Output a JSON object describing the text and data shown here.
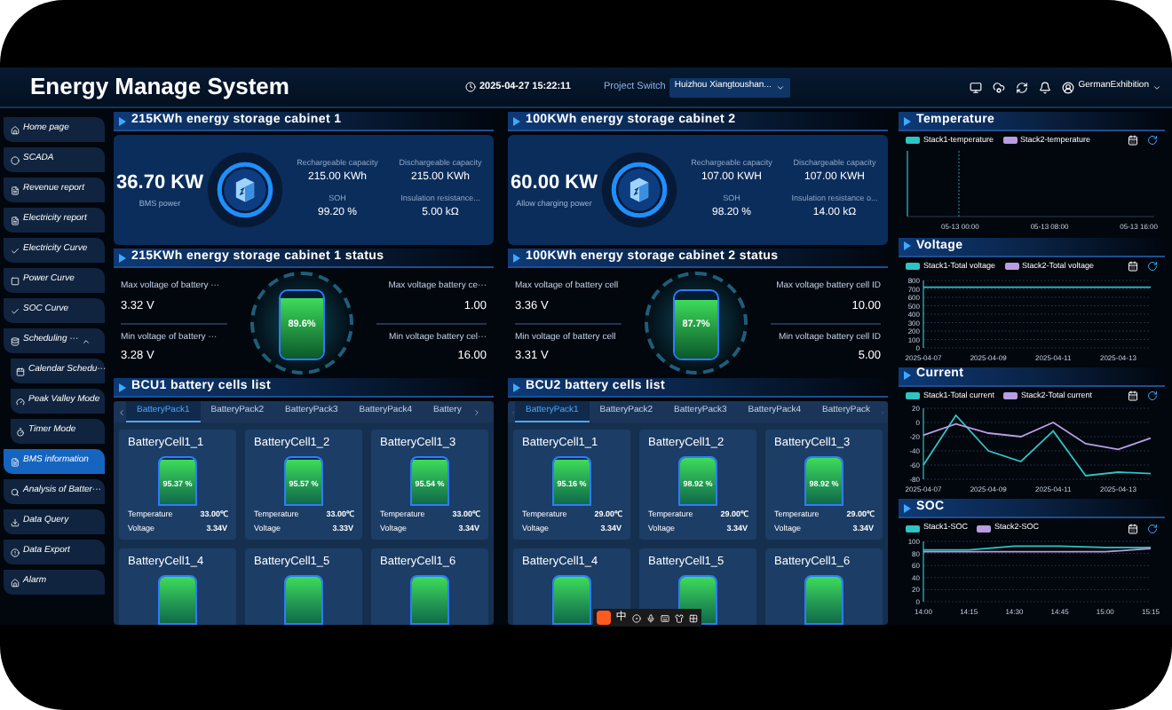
{
  "header": {
    "title": "Energy Manage System",
    "datetime": "2025-04-27 15:22:11",
    "project_switch_label": "Project Switch",
    "project_value": "Huizhou Xiangtoushan...",
    "user": "GermanExhibition"
  },
  "sidebar": {
    "items": [
      {
        "label": "Home page",
        "selected": false
      },
      {
        "label": "SCADA",
        "selected": false
      },
      {
        "label": "Revenue report",
        "selected": false
      },
      {
        "label": "Electricity report",
        "selected": false
      },
      {
        "label": "Electricity Curve",
        "selected": false
      },
      {
        "label": "Power Curve",
        "selected": false
      },
      {
        "label": "SOC Curve",
        "selected": false
      },
      {
        "label": "Scheduling ···",
        "selected": false,
        "expanded": true,
        "children": [
          {
            "label": "Calendar Schedu···",
            "selected": false
          },
          {
            "label": "Peak Valley Mode",
            "selected": false
          },
          {
            "label": "Timer Mode",
            "selected": false
          }
        ]
      },
      {
        "label": "BMS information",
        "selected": true
      },
      {
        "label": "Analysis of Batter···",
        "selected": false
      },
      {
        "label": "Data Query",
        "selected": false
      },
      {
        "label": "Data Export",
        "selected": false
      },
      {
        "label": "Alarm",
        "selected": false
      }
    ]
  },
  "cabinets": [
    {
      "title": "215KWh energy storage cabinet 1",
      "power_value": "36.70 KW",
      "power_label": "BMS power",
      "metrics": [
        {
          "label": "Rechargeable capacity",
          "value": "215.00 KWh"
        },
        {
          "label": "Dischargeable capacity",
          "value": "215.00 KWh"
        },
        {
          "label": "SOH",
          "value": "99.20 %"
        },
        {
          "label": "Insulation resistance...",
          "value": "5.00 kΩ"
        }
      ]
    },
    {
      "title": "100KWh energy storage cabinet 2",
      "power_value": "60.00 KW",
      "power_label": "Allow charging power",
      "metrics": [
        {
          "label": "Rechargeable capacity",
          "value": "107.00 KWH"
        },
        {
          "label": "Dischargeable capacity",
          "value": "107.00 KWH"
        },
        {
          "label": "SOH",
          "value": "98.20 %"
        },
        {
          "label": "Insulation resistance o...",
          "value": "14.00 kΩ"
        }
      ]
    }
  ],
  "statuses": [
    {
      "title": "215KWh energy storage cabinet 1 status",
      "percent": "89.6%",
      "level": 0.896,
      "left": [
        {
          "label": "Max voltage of battery ···",
          "value": "3.32 V"
        },
        {
          "label": "Min voltage of battery ···",
          "value": "3.28 V"
        }
      ],
      "right": [
        {
          "label": "Max voltage battery ce···",
          "value": "1.00"
        },
        {
          "label": "Min voltage battery cel···",
          "value": "16.00"
        }
      ]
    },
    {
      "title": "100KWh energy storage cabinet 2 status",
      "percent": "87.7%",
      "level": 0.877,
      "left": [
        {
          "label": "Max voltage of battery cell",
          "value": "3.36 V"
        },
        {
          "label": "Min voltage of battery cell",
          "value": "3.31 V"
        }
      ],
      "right": [
        {
          "label": "Max voltage battery cell ID",
          "value": "10.00"
        },
        {
          "label": "Min voltage battery cell ID",
          "value": "5.00"
        }
      ]
    }
  ],
  "cell_lists": [
    {
      "title": "BCU1 battery cells list",
      "tabs": [
        {
          "label": "BatteryPack1",
          "selected": true
        },
        {
          "label": "BatteryPack2",
          "selected": false
        },
        {
          "label": "BatteryPack3",
          "selected": false
        },
        {
          "label": "BatteryPack4",
          "selected": false
        },
        {
          "label": "Battery",
          "selected": false
        }
      ],
      "cells": [
        {
          "name": "BatteryCell1_1",
          "percent": "95.37 %",
          "level": 0.9537,
          "temperature_label": "Temperature",
          "temperature": "33.00℃",
          "voltage_label": "Voltage",
          "voltage": "3.34V"
        },
        {
          "name": "BatteryCell1_2",
          "percent": "95.57 %",
          "level": 0.9557,
          "temperature_label": "Temperature",
          "temperature": "33.00℃",
          "voltage_label": "Voltage",
          "voltage": "3.33V"
        },
        {
          "name": "BatteryCell1_3",
          "percent": "95.54 %",
          "level": 0.9554,
          "temperature_label": "Temperature",
          "temperature": "33.00℃",
          "voltage_label": "Voltage",
          "voltage": "3.34V"
        },
        {
          "name": "BatteryCell1_4"
        },
        {
          "name": "BatteryCell1_5"
        },
        {
          "name": "BatteryCell1_6"
        }
      ]
    },
    {
      "title": "BCU2 battery cells list",
      "tabs": [
        {
          "label": "BatteryPack1",
          "selected": true
        },
        {
          "label": "BatteryPack2",
          "selected": false
        },
        {
          "label": "BatteryPack3",
          "selected": false
        },
        {
          "label": "BatteryPack4",
          "selected": false
        },
        {
          "label": "BatteryPack",
          "selected": false
        }
      ],
      "cells": [
        {
          "name": "BatteryCell1_1",
          "percent": "95.16 %",
          "level": 0.9516,
          "temperature_label": "Temperature",
          "temperature": "29.00℃",
          "voltage_label": "Voltage",
          "voltage": "3.34V"
        },
        {
          "name": "BatteryCell1_2",
          "percent": "98.92 %",
          "level": 0.9892,
          "temperature_label": "Temperature",
          "temperature": "29.00℃",
          "voltage_label": "Voltage",
          "voltage": "3.34V"
        },
        {
          "name": "BatteryCell1_3",
          "percent": "98.92 %",
          "level": 0.9892,
          "temperature_label": "Temperature",
          "temperature": "29.00℃",
          "voltage_label": "Voltage",
          "voltage": "3.34V"
        },
        {
          "name": "BatteryCell1_4"
        },
        {
          "name": "BatteryCell1_5"
        },
        {
          "name": "BatteryCell1_6"
        }
      ]
    }
  ],
  "temperature": {
    "title": "Temperature",
    "legend": [
      {
        "name": "Stack1-temperature",
        "color": "#2ec4c4"
      },
      {
        "name": "Stack2-temperature",
        "color": "#b89ee0"
      }
    ],
    "x_labels": [
      "05-13 00:00",
      "05-13 08:00",
      "05-13 16:00"
    ]
  },
  "voltage": {
    "title": "Voltage",
    "chart_data": {
      "type": "line",
      "categories": [
        "2025-04-07",
        null,
        "2025-04-09",
        null,
        "2025-04-11",
        null,
        "2025-04-13",
        null
      ],
      "ylim": [
        0,
        800
      ],
      "yticks": [
        0,
        100,
        200,
        300,
        400,
        500,
        600,
        700,
        800
      ],
      "grid": true,
      "series": [
        {
          "name": "Stack1-Total voltage",
          "color": "#2ec4c4",
          "values": [
            720,
            720,
            720,
            720,
            720,
            720,
            720,
            720
          ]
        },
        {
          "name": "Stack2-Total voltage",
          "color": "#b89ee0",
          "values": [
            null,
            null,
            null,
            null,
            null,
            null,
            null,
            null
          ]
        }
      ]
    }
  },
  "current": {
    "title": "Current",
    "chart_data": {
      "type": "line",
      "categories": [
        "2025-04-07",
        null,
        "2025-04-09",
        null,
        "2025-04-11",
        null,
        "2025-04-13",
        null
      ],
      "ylim": [
        -80,
        20
      ],
      "yticks": [
        -80,
        -60,
        -40,
        -20,
        0,
        20
      ],
      "grid": true,
      "series": [
        {
          "name": "Stack1-Total current",
          "color": "#2ec4c4",
          "values": [
            -60,
            10,
            -40,
            -55,
            -12,
            -75,
            -70,
            -72
          ]
        },
        {
          "name": "Stack2-Total current",
          "color": "#b89ee0",
          "values": [
            -18,
            -2,
            -15,
            -20,
            0,
            -30,
            -38,
            -22
          ]
        }
      ]
    }
  },
  "soc": {
    "title": "SOC",
    "chart_data": {
      "type": "line",
      "categories": [
        "14:00",
        "14:15",
        "14:30",
        "14:45",
        "15:00",
        "15:15"
      ],
      "ylim": [
        0,
        100
      ],
      "yticks": [
        0,
        20,
        40,
        60,
        80,
        100
      ],
      "grid": true,
      "series": [
        {
          "name": "Stack1-SOC",
          "color": "#2ec4c4",
          "values": [
            86,
            86,
            92,
            92,
            90,
            90
          ]
        },
        {
          "name": "Stack2-SOC",
          "color": "#b89ee0",
          "values": [
            83,
            83,
            83,
            83,
            83,
            88
          ]
        }
      ]
    }
  },
  "ime_toolbar": {
    "mode": "中"
  }
}
